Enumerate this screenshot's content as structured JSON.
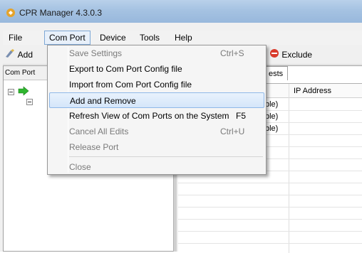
{
  "window": {
    "title": "CPR Manager 4.3.0.3"
  },
  "menubar": {
    "items": [
      "File",
      "Com Port",
      "Device",
      "Tools",
      "Help"
    ]
  },
  "toolbar": {
    "add_label": "Add",
    "exclude_label": "Exclude"
  },
  "left_panel": {
    "header": "Com Port"
  },
  "right_panel": {
    "tab_label": "ests",
    "columns": [
      "IP Address"
    ],
    "rows": [
      "ble)",
      "ble)",
      "ble)"
    ]
  },
  "dropdown": {
    "items": [
      {
        "label": "Save Settings",
        "shortcut": "Ctrl+S",
        "enabled": false
      },
      {
        "label": "Export to Com Port Config file",
        "shortcut": "",
        "enabled": true
      },
      {
        "label": "Import from Com Port Config file",
        "shortcut": "",
        "enabled": true
      },
      {
        "label": "Add and Remove",
        "shortcut": "",
        "enabled": true,
        "highlighted": true
      },
      {
        "label": "Refresh View of Com Ports on the System",
        "shortcut": "F5",
        "enabled": true
      },
      {
        "label": "Cancel All Edits",
        "shortcut": "Ctrl+U",
        "enabled": false
      },
      {
        "label": "Release Port",
        "shortcut": "",
        "enabled": false
      },
      {
        "label": "Close",
        "shortcut": "",
        "enabled": false
      }
    ]
  },
  "colors": {
    "title_bar": "#a5c2e2",
    "menu_highlight": "#d5e6fa",
    "disabled_text": "#7a7a7a",
    "tree_arrow": "#2fb62f",
    "exclude_icon": "#d93a2b"
  },
  "icons": [
    "app-icon",
    "add-icon",
    "exclude-icon",
    "arrow-right-icon"
  ]
}
